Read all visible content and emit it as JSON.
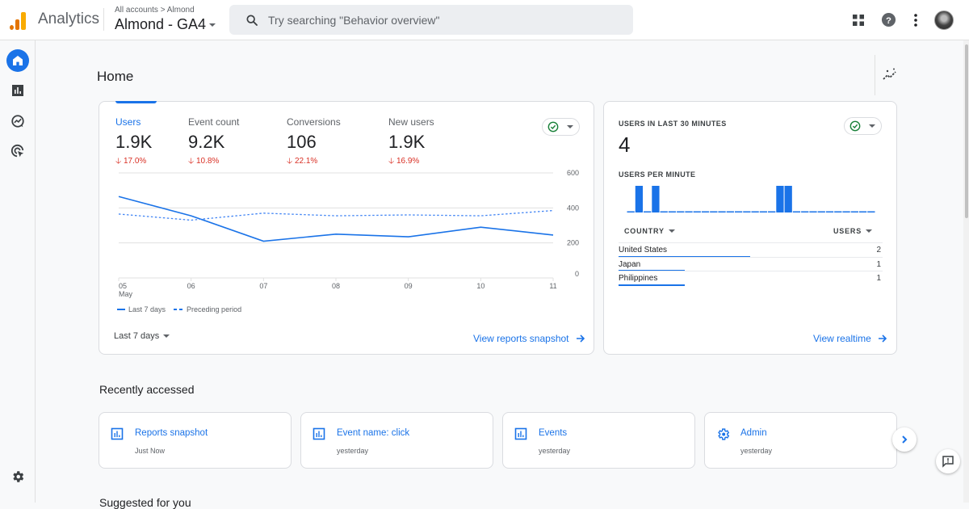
{
  "header": {
    "brand": "Analytics",
    "breadcrumb": "All accounts > Almond",
    "property_name": "Almond - GA4",
    "search_placeholder": "Try searching \"Behavior overview\"",
    "icons": [
      "apps-grid-icon",
      "help-icon",
      "more-vert-icon",
      "account-avatar"
    ]
  },
  "sidenav": {
    "items": [
      {
        "name": "home",
        "icon": "home-icon",
        "active": true
      },
      {
        "name": "reports",
        "icon": "bar-chart-icon",
        "active": false
      },
      {
        "name": "explore",
        "icon": "explore-icon",
        "active": false
      },
      {
        "name": "advertising",
        "icon": "advertising-icon",
        "active": false
      }
    ],
    "footer_icon": "settings-gear-icon"
  },
  "page": {
    "title": "Home",
    "insights_icon": "insights-icon"
  },
  "overview_card": {
    "metrics": [
      {
        "label": "Users",
        "value": "1.9K",
        "change": "17.0%",
        "direction": "down",
        "active": true
      },
      {
        "label": "Event count",
        "value": "9.2K",
        "change": "10.8%",
        "direction": "down",
        "active": false
      },
      {
        "label": "Conversions",
        "value": "106",
        "change": "22.1%",
        "direction": "down",
        "active": false
      },
      {
        "label": "New users",
        "value": "1.9K",
        "change": "16.9%",
        "direction": "down",
        "active": false
      }
    ],
    "date_range": "Last 7 days",
    "link": "View reports snapshot",
    "legend": {
      "current": "Last 7 days",
      "previous": "Preceding period"
    }
  },
  "chart_data": [
    {
      "type": "line",
      "title": "Users",
      "x": [
        "05",
        "06",
        "07",
        "08",
        "09",
        "10",
        "11"
      ],
      "x_sublabel": {
        "05": "May"
      },
      "series": [
        {
          "name": "Last 7 days",
          "style": "solid",
          "values": [
            465,
            355,
            210,
            250,
            235,
            290,
            245
          ]
        },
        {
          "name": "Preceding period",
          "style": "dashed",
          "values": [
            365,
            330,
            370,
            355,
            360,
            355,
            385
          ]
        }
      ],
      "yticks": [
        0,
        200,
        400,
        600
      ],
      "ylim": [
        0,
        600
      ],
      "y_axis_side": "right",
      "grid": true,
      "legend": "bottom-left"
    },
    {
      "type": "bar",
      "title": "USERS PER MINUTE",
      "values": [
        0,
        1,
        0,
        1,
        0,
        0,
        0,
        0,
        0,
        0,
        0,
        0,
        0,
        0,
        0,
        0,
        0,
        0,
        1,
        1,
        0,
        0,
        0,
        0,
        0,
        0,
        0,
        0,
        0,
        0
      ],
      "ylim": [
        0,
        1
      ]
    }
  ],
  "realtime_card": {
    "title": "USERS IN LAST 30 MINUTES",
    "value": "4",
    "subtitle": "USERS PER MINUTE",
    "col_country": "COUNTRY",
    "col_users": "USERS",
    "rows": [
      {
        "country": "United States",
        "users": 2
      },
      {
        "country": "Japan",
        "users": 1
      },
      {
        "country": "Philippines",
        "users": 1
      }
    ],
    "link": "View realtime"
  },
  "recently_accessed": {
    "title": "Recently accessed",
    "items": [
      {
        "title": "Reports snapshot",
        "time": "Just Now",
        "icon": "report-icon"
      },
      {
        "title": "Event name: click",
        "time": "yesterday",
        "icon": "report-icon"
      },
      {
        "title": "Events",
        "time": "yesterday",
        "icon": "report-icon"
      },
      {
        "title": "Admin",
        "time": "yesterday",
        "icon": "settings-gear-icon"
      }
    ]
  },
  "next_section_title": "Suggested for you",
  "colors": {
    "accent": "#1a73e8",
    "negative": "#d93025",
    "positive_check": "#188038",
    "logo_orange": "#f9ab00",
    "logo_dark_orange": "#e37400"
  }
}
